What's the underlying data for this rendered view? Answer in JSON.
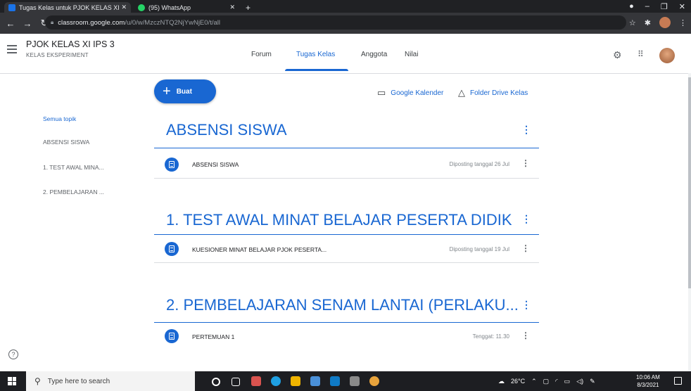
{
  "browser": {
    "tabs": [
      {
        "title": "Tugas Kelas untuk PJOK KELAS XI",
        "active": true,
        "favicon_color": "#1a73e8"
      },
      {
        "title": "(95) WhatsApp",
        "active": false,
        "favicon_color": "#25d366"
      }
    ],
    "new_tab": "+",
    "url_host": "classroom.google.com",
    "url_path": "/u/0/w/MzczNTQ2NjYwNjE0/t/all"
  },
  "header": {
    "class_name": "PJOK KELAS XI IPS 3",
    "class_section": "KELAS EKSPERIMENT",
    "tabs": [
      {
        "label": "Forum",
        "active": false
      },
      {
        "label": "Tugas Kelas",
        "active": true
      },
      {
        "label": "Anggota",
        "active": false
      },
      {
        "label": "Nilai",
        "active": false
      }
    ]
  },
  "toolbar": {
    "create_label": "Buat",
    "calendar_label": "Google Kalender",
    "drive_label": "Folder Drive Kelas"
  },
  "sidebar": {
    "items": [
      {
        "label": "Semua topik",
        "selected": true
      },
      {
        "label": "ABSENSI SISWA",
        "selected": false
      },
      {
        "label": "1. TEST AWAL MINA...",
        "selected": false
      },
      {
        "label": "2. PEMBELAJARAN ...",
        "selected": false
      }
    ]
  },
  "topics": [
    {
      "title": "ABSENSI SISWA",
      "assignments": [
        {
          "title": "ABSENSI SISWA",
          "meta": "Diposting tanggal 26 Jul"
        }
      ]
    },
    {
      "title": "1. TEST AWAL MINAT BELAJAR PESERTA DIDIK",
      "assignments": [
        {
          "title": "KUESIONER MINAT BELAJAR PJOK PESERTA...",
          "meta": "Diposting tanggal 19 Jul"
        }
      ]
    },
    {
      "title": "2. PEMBELAJARAN SENAM LANTAI (PERLAKU...",
      "assignments": [
        {
          "title": "PERTEMUAN 1",
          "meta": "Tenggat: 11.30"
        }
      ]
    }
  ],
  "taskbar": {
    "search_placeholder": "Type here to search",
    "weather": "26°C",
    "time": "10:06 AM",
    "date": "8/3/2021"
  },
  "colors": {
    "accent": "#1967d2",
    "chrome_dark": "#202124"
  }
}
